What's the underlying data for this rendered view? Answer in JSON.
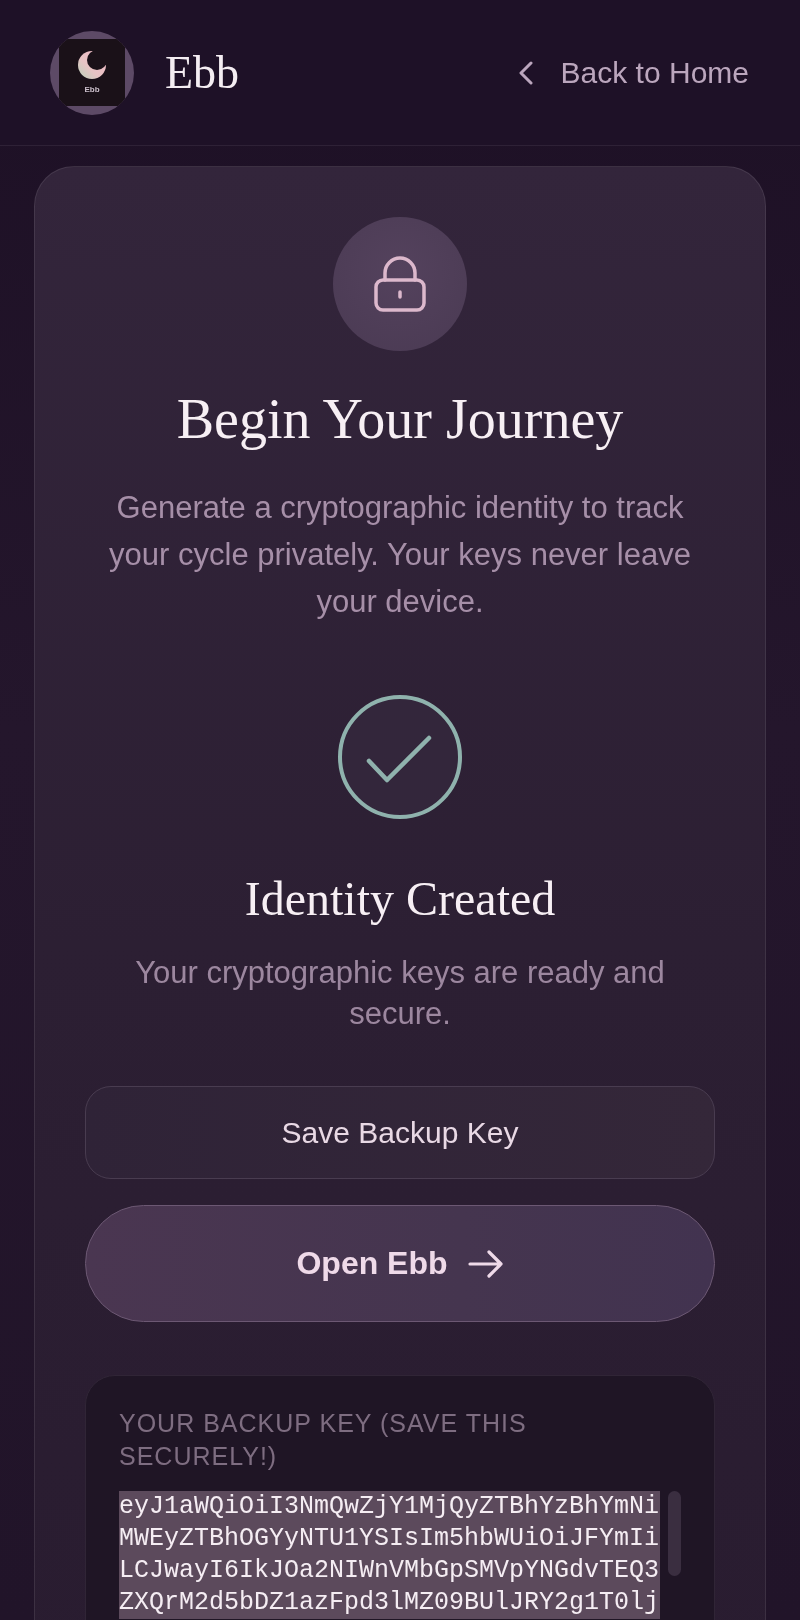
{
  "header": {
    "logo": {
      "label": "Ebb"
    },
    "brand": "Ebb",
    "back_link": "Back to Home"
  },
  "intro": {
    "title": "Begin Your Journey",
    "description": "Generate a cryptographic identity to track your cycle privately. Your keys never leave your device."
  },
  "status": {
    "kind": "success",
    "title": "Identity Created",
    "message": "Your cryptographic keys are ready and secure."
  },
  "buttons": [
    {
      "label": "Save Backup Key",
      "kind": "secondary"
    },
    {
      "label": "Open Ebb",
      "kind": "primary"
    }
  ],
  "backup_key": {
    "label": "YOUR BACKUP KEY (SAVE THIS SECURELY!)",
    "value": "eyJ1aWQiOiI3NmQwZjY1MjQyZTBhYzBhYmNiMWEyZTBhOGYyNTU1YSIsIm5hbWUiOiJFYmIiLCJwayI6IkJOa2NIWnVMbGpSMVpYNGdvTEQ3ZXQrM2d5bDZ1azFpd3lMZ09BUlJRY2g1T0lj",
    "highlighted": true
  }
}
